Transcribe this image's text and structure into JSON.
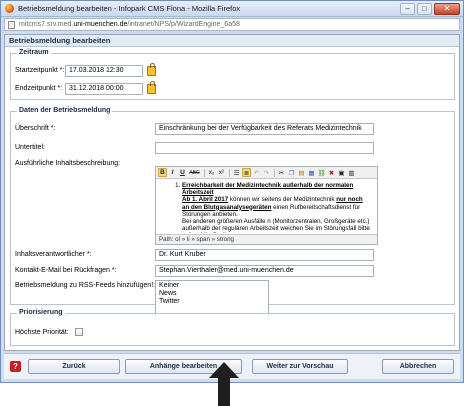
{
  "window": {
    "title": "Betriebsmeldung bearbeiten - Infopark CMS Fiona - Mozilla Firefox",
    "url_prefix": "mitcms7.srv.med.",
    "url_domain": "uni-muenchen.de",
    "url_path": "/intranet/NPS/p/WizardEngine_6a58"
  },
  "page": {
    "heading": "Betriebsmeldung bearbeiten"
  },
  "zeitraum": {
    "legend": "Zeitraum",
    "start_label": "Startzeitpunkt *:",
    "start_value": "17.03.2018 12:30",
    "end_label": "Endzeitpunkt *:",
    "end_value": "31.12.2018 00:00"
  },
  "daten": {
    "legend": "Daten der Betriebsmeldung",
    "ueberschrift_label": "Überschrift *:",
    "ueberschrift_value": "Einschränkung bei der Verfügbarkeit des Referats Medizintechnik",
    "untertitel_label": "Untertitel:",
    "untertitel_value": "",
    "beschreibung_label": "Ausführliche Inhaltsbeschreibung:",
    "editor_line1_bold": "Erreichbarkeit der Medizintechnik außerhalb der normalen Arbeitszeit",
    "editor_line2_bold": "Ab 1. Abril 2017",
    "editor_line2_rest": " können wir seitens der Medizintechnik ",
    "editor_line2_bold2": "nur noch an den Blutgasanalysegeräten",
    "editor_line2_tail": " einen Rufbereitschaftsdienst für Störungen anbieten.",
    "editor_line3": "Bei anderen größeren Ausfälle n (Monitorzentralen, Großgeräte etc.) außerhalb der regulären Arbeitszeit weichen Sie im Störungsfall bitte auf mobile Geräte aus.",
    "editor_path": "Path: ol » li » span » strong",
    "verantwortlich_label": "Inhaltsverantwortlicher *:",
    "verantwortlich_value": "Dr. Kurt Kruber",
    "email_label": "Kontakt-E-Mail bei Rückfragen *:",
    "email_value": "Stephan.Vierthaler@med.uni-muenchen.de",
    "rss_label": "Betriebsmeldung zu RSS-Feeds hinzufügen!:",
    "rss_options": [
      "Keiner",
      "News",
      "Twitter"
    ]
  },
  "priorisierung": {
    "legend": "Priorisierung",
    "hoechste_label": "Höchste Priorität:"
  },
  "toolbar": {
    "bold": "B",
    "italic": "I",
    "underline": "U",
    "strike": "ABC",
    "sub": "x₂",
    "sup": "x²"
  },
  "footer": {
    "help": "?",
    "back_label": "Zurück",
    "attachments_label": "Anhänge bearbeiten",
    "preview_label": "Weiter zur Vorschau",
    "cancel_label": "Abbrechen"
  },
  "colors": {
    "header_bg": "#e3ebf5",
    "lock_icon": "#f3c331",
    "help_icon": "#c71f1f"
  }
}
